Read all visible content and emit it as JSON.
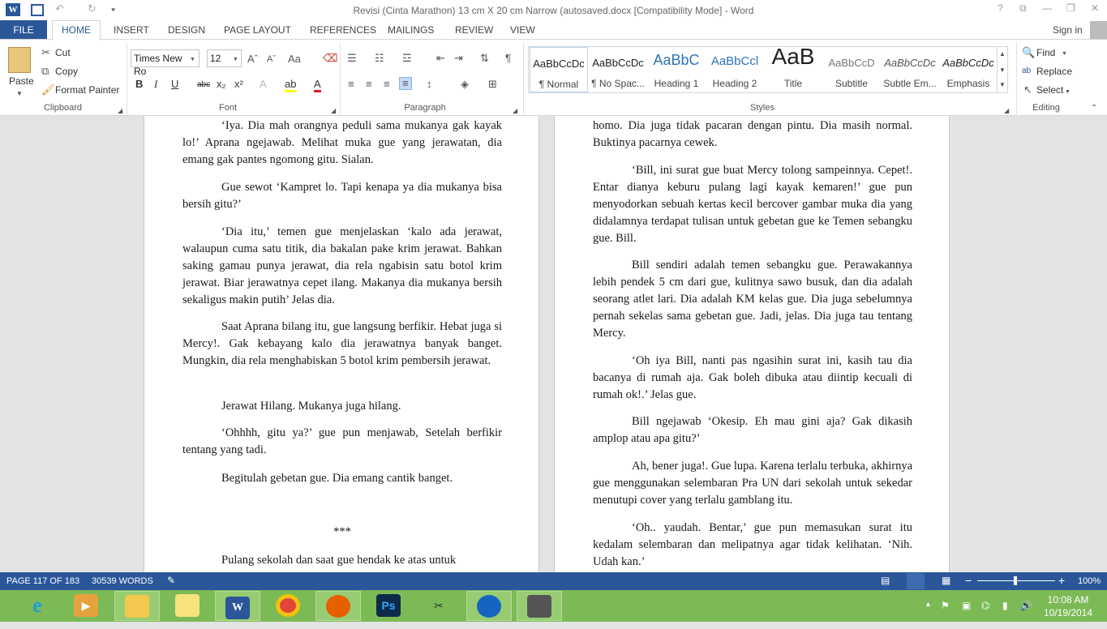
{
  "window": {
    "title": "Revisi (Cinta Marathon) 13 cm X 20 cm Narrow (autosaved.docx [Compatibility Mode] - Word",
    "help": "?",
    "restore": "⧉",
    "minimize": "—",
    "maximize": "❐",
    "close": "✕"
  },
  "quick_access": {
    "undo": "↶",
    "redo": "↻",
    "customize": "⯆"
  },
  "tabs": {
    "file": "FILE",
    "home": "HOME",
    "insert": "INSERT",
    "design": "DESIGN",
    "page_layout": "PAGE LAYOUT",
    "references": "REFERENCES",
    "mailings": "MAILINGS",
    "review": "REVIEW",
    "view": "VIEW"
  },
  "signin": "Sign in",
  "clipboard": {
    "paste": "Paste",
    "cut": "Cut",
    "copy": "Copy",
    "format_painter": "Format Painter",
    "label": "Clipboard"
  },
  "font": {
    "family": "Times New Ro",
    "size": "12",
    "grow": "Aˆ",
    "shrink": "Aˇ",
    "case": "Aa",
    "bold": "B",
    "italic": "I",
    "underline": "U",
    "strike": "abc",
    "subscript": "x₂",
    "superscript": "x²",
    "effects": "A",
    "highlight": "ab",
    "color": "A",
    "label": "Font"
  },
  "paragraph": {
    "label": "Paragraph",
    "pilcrow": "¶"
  },
  "styles": {
    "label": "Styles",
    "items": [
      {
        "preview": "AaBbCcDc",
        "name": "¶ Normal"
      },
      {
        "preview": "AaBbCcDc",
        "name": "¶ No Spac..."
      },
      {
        "preview": "AaBbC",
        "name": "Heading 1"
      },
      {
        "preview": "AaBbCcl",
        "name": "Heading 2"
      },
      {
        "preview": "AaB",
        "name": "Title"
      },
      {
        "preview": "AaBbCcD",
        "name": "Subtitle"
      },
      {
        "preview": "AaBbCcDc",
        "name": "Subtle Em..."
      },
      {
        "preview": "AaBbCcDc",
        "name": "Emphasis"
      }
    ]
  },
  "editing": {
    "find": "Find",
    "replace": "Replace",
    "select": "Select",
    "label": "Editing"
  },
  "page_left": {
    "paragraphs": [
      "‘Iya. Dia mah orangnya peduli sama mukanya gak kayak lo!’ Aprana ngejawab. Melihat muka gue yang jerawatan, dia emang gak pantes ngomong gitu. Sialan.",
      "Gue sewot ‘Kampret lo. Tapi kenapa ya dia mukanya bisa bersih gitu?’",
      "‘Dia itu,’ temen gue menjelaskan ‘kalo ada jerawat, walaupun cuma satu titik, dia bakalan pake krim jerawat. Bahkan saking gamau punya jerawat, dia rela ngabisin satu botol krim jerawat. Biar jerawatnya cepet ilang. Makanya dia mukanya bersih sekaligus makin putih’ Jelas dia.",
      "Saat Aprana bilang itu, gue langsung berfikir. Hebat juga si Mercy!. Gak kebayang kalo dia jerawatnya banyak banget. Mungkin, dia rela menghabiskan 5 botol krim pembersih jerawat.",
      "Jerawat Hilang. Mukanya juga hilang.",
      "‘Ohhhh, gitu ya?’ gue pun menjawab, Setelah berfikir tentang yang tadi.",
      "Begitulah gebetan gue. Dia emang cantik banget.",
      "***",
      "Pulang sekolah dan saat gue hendak ke atas untuk"
    ]
  },
  "page_right": {
    "paragraphs": [
      "homo. Dia juga tidak pacaran dengan pintu. Dia masih normal. Buktinya pacarnya cewek.",
      "‘Bill, ini surat gue buat Mercy tolong sampeinnya. Cepet!. Entar dianya keburu pulang lagi kayak kemaren!’ gue pun menyodorkan sebuah kertas kecil  bercover gambar muka dia yang didalamnya terdapat tulisan untuk gebetan gue ke Temen sebangku gue. Bill.",
      "Bill sendiri adalah temen sebangku gue. Perawakannya lebih pendek 5 cm dari gue, kulitnya sawo busuk, dan dia adalah seorang atlet lari. Dia adalah KM kelas gue. Dia juga sebelumnya  pernah sekelas sama gebetan gue. Jadi, jelas. Dia juga tau tentang Mercy.",
      "‘Oh iya Bill, nanti pas ngasihin surat ini, kasih tau dia bacanya di rumah aja. Gak boleh dibuka atau diintip kecuali di rumah ok!.’ Jelas gue.",
      "Bill ngejawab ‘Okesip. Eh mau gini aja? Gak dikasih amplop atau apa gitu?’",
      "Ah, bener juga!. Gue lupa. Karena terlalu terbuka, akhirnya gue menggunakan selembaran Pra UN dari sekolah untuk sekedar menutupi cover yang terlalu gamblang itu.",
      "‘Oh.. yaudah. Bentar,’ gue pun memasukan surat itu kedalam selembaran dan melipatnya agar tidak kelihatan. ‘Nih. Udah kan.’"
    ]
  },
  "status": {
    "page": "PAGE 117 OF 183",
    "words": "30539 WORDS",
    "zoom": "100%",
    "zoom_minus": "−",
    "zoom_plus": "+"
  },
  "taskbar": {
    "time": "10:08 AM",
    "date": "10/19/2014",
    "apps": [
      "internet-explorer",
      "media",
      "file-explorer",
      "sticky-notes",
      "word",
      "chrome",
      "firefox",
      "photoshop",
      "paint",
      "app-blue",
      "app-gray"
    ]
  },
  "colors": {
    "accent": "#2b579a",
    "taskbar": "#7cba55"
  }
}
